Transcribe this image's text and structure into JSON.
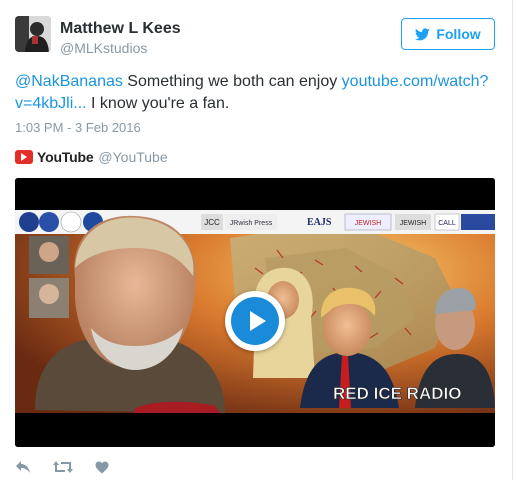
{
  "author": {
    "name": "Matthew L Kees",
    "handle": "@MLKstudios",
    "avatar_icon": "profile-photo"
  },
  "follow_button": {
    "label": "Follow",
    "icon": "twitter-bird-icon"
  },
  "tweet": {
    "mention": "@NakBananas",
    "text_before_link": " Something we both can enjoy ",
    "link_line1": "youtube.com/watch?",
    "link_line2": "v=4kbJli...",
    "text_after_link": " I know you're a fan.",
    "timestamp": "1:03 PM - 3 Feb 2016"
  },
  "card": {
    "source_name": "YouTube",
    "source_handle": "@YouTube",
    "video": {
      "watermark": "RED ICE RADIO",
      "banner_text_1": "JCC",
      "banner_text_2": "EAJS",
      "banner_text_3": "JEWISH",
      "banner_text_4": "JEWISH",
      "banner_text_5": "JRwish Press",
      "banner_text_6": "CALL",
      "play_icon": "play-button-icon"
    }
  },
  "actions": {
    "reply_icon": "reply-icon",
    "retweet_icon": "retweet-icon",
    "like_icon": "heart-icon"
  },
  "colors": {
    "link": "#1b95e0",
    "twitter_blue": "#1da1f2",
    "youtube_red": "#e52d27",
    "muted": "#8899a6",
    "text": "#292f33"
  }
}
